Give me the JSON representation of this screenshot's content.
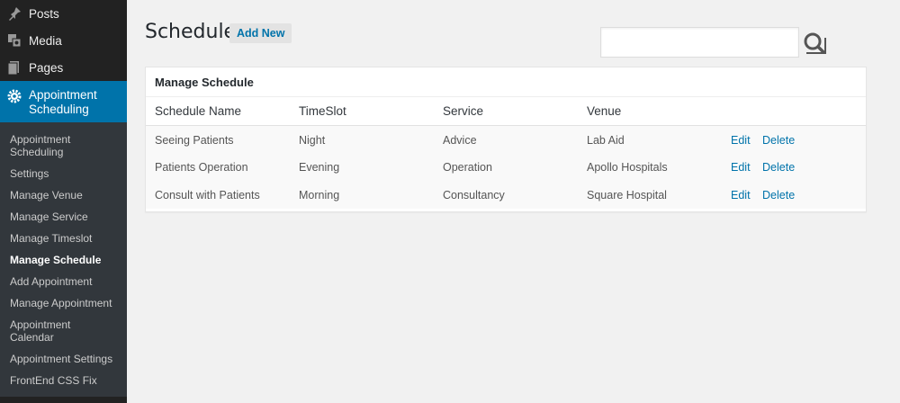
{
  "sidebar": {
    "top_items": [
      {
        "label": "Posts",
        "icon": "pushpin-icon"
      },
      {
        "label": "Media",
        "icon": "media-icon"
      },
      {
        "label": "Pages",
        "icon": "pages-icon"
      }
    ],
    "active_item": {
      "label_line1": "Appointment",
      "label_line2": "Scheduling",
      "icon": "gear-icon"
    },
    "sub_items": [
      {
        "label_line1": "Appointment",
        "label_line2": "Scheduling"
      },
      {
        "label": "Settings"
      },
      {
        "label": "Manage Venue"
      },
      {
        "label": "Manage Service"
      },
      {
        "label": "Manage Timeslot"
      },
      {
        "label": "Manage Schedule",
        "current": true
      },
      {
        "label": "Add Appointment"
      },
      {
        "label": "Manage Appointment"
      },
      {
        "label_line1": "Appointment",
        "label_line2": "Calendar"
      },
      {
        "label": "Appointment Settings"
      },
      {
        "label": "FrontEnd CSS Fix"
      }
    ]
  },
  "header": {
    "title": "Schedule",
    "add_new_label": "Add New",
    "search_value": ""
  },
  "panel": {
    "title": "Manage Schedule",
    "columns": [
      "Schedule Name",
      "TimeSlot",
      "Service",
      "Venue"
    ],
    "rows": [
      {
        "name": "Seeing Patients",
        "timeslot": "Night",
        "service": "Advice",
        "venue": "Lab Aid",
        "edit": "Edit",
        "delete": "Delete"
      },
      {
        "name": "Patients Operation",
        "timeslot": "Evening",
        "service": "Operation",
        "venue": "Apollo Hospitals",
        "edit": "Edit",
        "delete": "Delete"
      },
      {
        "name": "Consult with Patients",
        "timeslot": "Morning",
        "service": "Consultancy",
        "venue": "Square Hospital",
        "edit": "Edit",
        "delete": "Delete"
      }
    ]
  },
  "colors": {
    "accent": "#0073aa",
    "sidebar_bg": "#222222",
    "submenu_bg": "#32373c"
  }
}
